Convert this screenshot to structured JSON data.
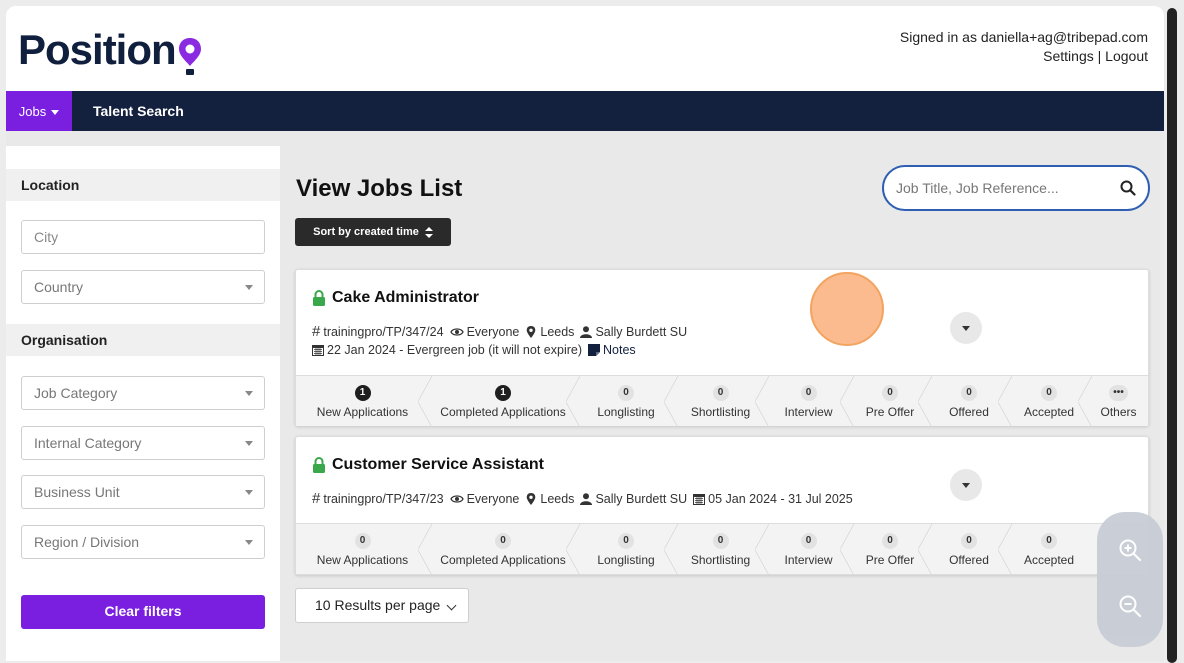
{
  "header": {
    "logo_text": "Position",
    "signed_in_text": "Signed in as daniella+ag@tribepad.com",
    "settings_label": "Settings",
    "separator": "|",
    "logout_label": "Logout"
  },
  "nav": {
    "jobs_label": "Jobs",
    "talent_search_label": "Talent Search"
  },
  "sidebar": {
    "location_heading": "Location",
    "city_placeholder": "City",
    "country_label": "Country",
    "organisation_heading": "Organisation",
    "job_category_label": "Job Category",
    "internal_category_label": "Internal Category",
    "business_unit_label": "Business Unit",
    "region_division_label": "Region / Division",
    "clear_filters_label": "Clear filters"
  },
  "main": {
    "page_title": "View Jobs List",
    "search_placeholder": "Job Title, Job Reference...",
    "sort_label": "Sort by created time",
    "results_per_page_label": "10 Results per page"
  },
  "jobs": [
    {
      "title": "Cake Administrator",
      "reference": "trainingpro/TP/347/24",
      "visibility": "Everyone",
      "location": "Leeds",
      "owner": "Sally Burdett SU",
      "dates": "22 Jan 2024 - Evergreen job (it will not expire)",
      "notes_label": "Notes",
      "stages": [
        {
          "label": "New Applications",
          "count": "1"
        },
        {
          "label": "Completed Applications",
          "count": "1"
        },
        {
          "label": "Longlisting",
          "count": "0"
        },
        {
          "label": "Shortlisting",
          "count": "0"
        },
        {
          "label": "Interview",
          "count": "0"
        },
        {
          "label": "Pre Offer",
          "count": "0"
        },
        {
          "label": "Offered",
          "count": "0"
        },
        {
          "label": "Accepted",
          "count": "0"
        },
        {
          "label": "Others",
          "count": "•••"
        }
      ]
    },
    {
      "title": "Customer Service Assistant",
      "reference": "trainingpro/TP/347/23",
      "visibility": "Everyone",
      "location": "Leeds",
      "owner": "Sally Burdett SU",
      "dates": "05 Jan 2024 - 31 Jul 2025",
      "stages": [
        {
          "label": "New Applications",
          "count": "0"
        },
        {
          "label": "Completed Applications",
          "count": "0"
        },
        {
          "label": "Longlisting",
          "count": "0"
        },
        {
          "label": "Shortlisting",
          "count": "0"
        },
        {
          "label": "Interview",
          "count": "0"
        },
        {
          "label": "Pre Offer",
          "count": "0"
        },
        {
          "label": "Offered",
          "count": "0"
        },
        {
          "label": "Accepted",
          "count": "0"
        }
      ]
    }
  ],
  "colors": {
    "brand_purple": "#7a1fe0",
    "navy": "#13213f",
    "lock_green": "#3aa84a",
    "search_border": "#2f5fb3"
  }
}
